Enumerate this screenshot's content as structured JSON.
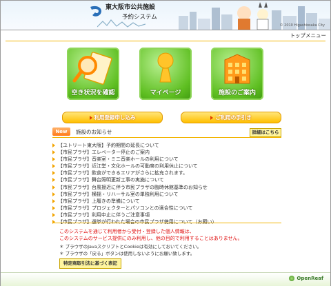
{
  "header": {
    "title": "東大阪市公共施設",
    "subtitle": "予約システム",
    "copyright": "© 2010 Higashiosaka City"
  },
  "topbar": {
    "top_menu": "トップメニュー"
  },
  "tiles": [
    {
      "label": "空き状況を確認",
      "icon": "magnifier-icon"
    },
    {
      "label": "マイページ",
      "icon": "person-icon"
    },
    {
      "label": "施設のご案内",
      "icon": "building-icon"
    }
  ],
  "buttons": {
    "register": "利用登録申し込み",
    "guide": "ご利用の手引き"
  },
  "news": {
    "badge": "New",
    "title": "施設のお知らせ",
    "detail": "詳細はこちら",
    "items": [
      "【ユトリート東大阪】予約期間の延長について",
      "【市民プラザ】エレベーター停止のご案内",
      "【市民プラザ】音楽室・ミニ音楽ホールの利用について",
      "【市民プラザ】近江堂・文化ホールの可動席の利用休止について",
      "【市民プラザ】飲食ができるエリアがさらに拡充されます。",
      "【市民プラザ】舞台照明更新工事の実施について",
      "【市民プラザ】台風接近に伴う市民プラザの臨時休館基準のお知らせ",
      "【市民プラザ】横揺・リハーサル室の単独利用について",
      "【市民プラザ】上履きの準備について",
      "【市民プラザ】プロジェクターとパソコンとの適合性について",
      "【市民プラザ】利用中止に伴うご注意事項",
      "【市民プラザ】選挙が行われた場合の市民プラザ使用について（お願い）"
    ]
  },
  "notices": {
    "warn1": "このシステムを通じて利用者から受付・登録した個人情報は、",
    "warn2": "このシステムのサービス提供にのみ利用し、他の目的で利用することはありません。",
    "note1": "＊ ブラウザのJavaスクリプトとCookieは有効にしておいてください。",
    "note2": "＊ ブラウザの「戻る」ボタンは使用しないようにお願い致します。",
    "law_button": "特定商取引法に基づく表記"
  },
  "footer": {
    "brand": "OpenReaf"
  },
  "colors": {
    "accent": "#f2b400",
    "tile_green": "#5fbf22",
    "warn_red": "#e01010"
  }
}
